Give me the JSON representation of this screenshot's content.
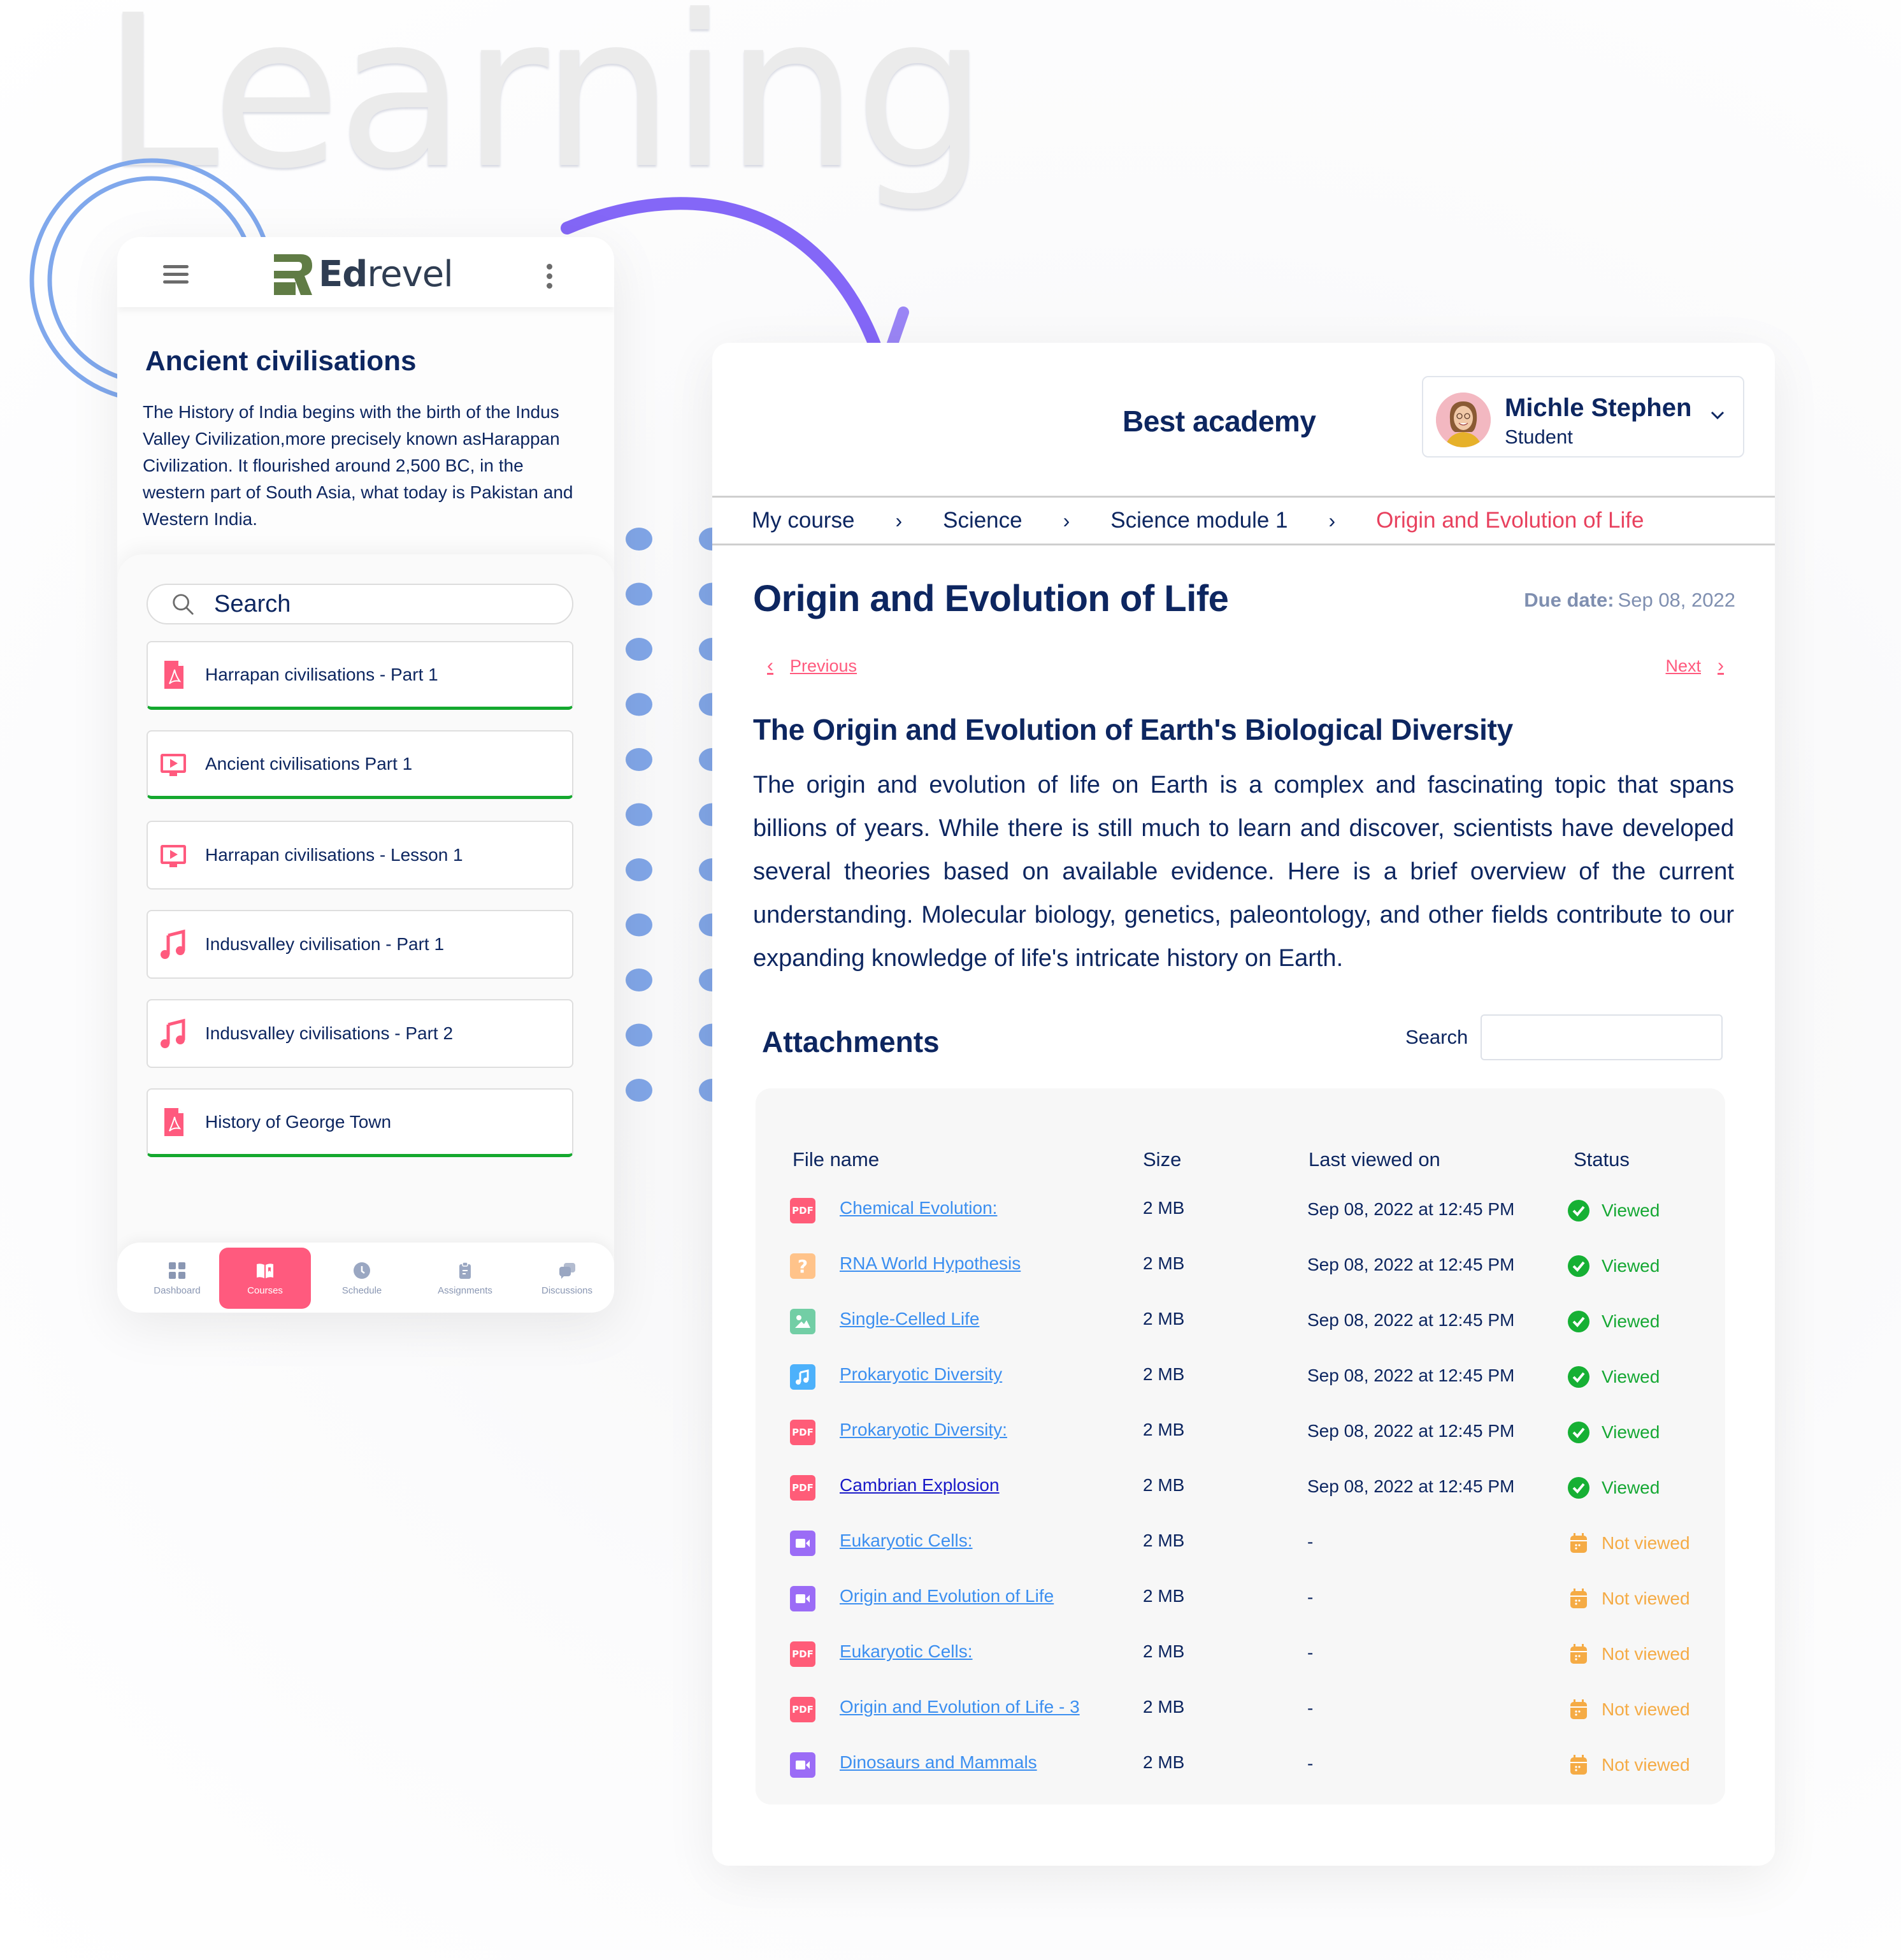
{
  "background": {
    "word": "Learning"
  },
  "colors": {
    "navy": "#0d2660",
    "accent_pink": "#ff5a7e",
    "breadcrumb_current": "#e8415e",
    "viewed_green": "#16a834",
    "not_viewed_orange": "#f5ab45",
    "link_blue": "#3c8ff0",
    "logo_green": "#607c45",
    "deco_blue": "#80a8ec",
    "deco_purple": "#8467f7"
  },
  "mobile": {
    "header": {
      "brand_bold": "Ed",
      "brand_light": "revel",
      "menu_icon": "hamburger-icon",
      "more_icon": "kebab-icon"
    },
    "title": "Ancient civilisations",
    "description": "The History of India begins with the birth of the Indus Valley Civilization,more precisely known asHarappan Civilization. It flourished around 2,500 BC, in the western part of South Asia, what today is Pakistan and Western India.",
    "search": {
      "placeholder": "Search",
      "icon": "search-icon"
    },
    "lessons": [
      {
        "label": "Harrapan civilisations - Part 1",
        "type": "pdf",
        "completed": true
      },
      {
        "label": "Ancient civilisations Part 1",
        "type": "video",
        "completed": true
      },
      {
        "label": "Harrapan civilisations - Lesson 1",
        "type": "video",
        "completed": false
      },
      {
        "label": "Indusvalley civilisation - Part 1",
        "type": "audio",
        "completed": false
      },
      {
        "label": "Indusvalley civilisations - Part 2",
        "type": "audio",
        "completed": false
      },
      {
        "label": "History of George Town",
        "type": "pdf",
        "completed": true
      }
    ],
    "bottom_nav": [
      {
        "label": "Dashboard",
        "icon": "dashboard-icon",
        "active": false
      },
      {
        "label": "Courses",
        "icon": "book-icon",
        "active": true
      },
      {
        "label": "Schedule",
        "icon": "clock-icon",
        "active": false
      },
      {
        "label": "Assignments",
        "icon": "clipboard-icon",
        "active": false
      },
      {
        "label": "Discussions",
        "icon": "chat-icon",
        "active": false
      }
    ]
  },
  "desktop": {
    "academy_name": "Best academy",
    "user": {
      "name": "Michle Stephen",
      "role": "Student"
    },
    "breadcrumb": [
      "My course",
      "Science",
      "Science module 1",
      "Origin and Evolution of Life"
    ],
    "page_title": "Origin and Evolution of Life",
    "due_label": "Due date:",
    "due_value": "Sep 08, 2022",
    "prev_label": "Previous",
    "next_label": "Next",
    "section_title": "The Origin and Evolution of Earth's Biological Diversity",
    "body": "The origin and evolution of life on Earth is a complex and fascinating topic that spans billions of years. While there is still much to learn and discover, scientists have developed several theories based on available evidence. Here is a brief overview of the current understanding. Molecular biology, genetics, paleontology, and other fields contribute to our expanding knowledge of life's intricate history on Earth.",
    "attachments": {
      "title": "Attachments",
      "search_label": "Search",
      "search_value": "",
      "columns": [
        "File name",
        "Size",
        "Last viewed on",
        "Status"
      ],
      "rows": [
        {
          "name": "Chemical Evolution:",
          "type": "pdf",
          "size": "2 MB",
          "last_viewed": "Sep 08, 2022 at 12:45 PM",
          "status": "Viewed",
          "visited": false
        },
        {
          "name": "RNA World Hypothesis",
          "type": "unknown",
          "size": "2 MB",
          "last_viewed": "Sep 08, 2022 at 12:45 PM",
          "status": "Viewed",
          "visited": false
        },
        {
          "name": "Single-Celled Life",
          "type": "image",
          "size": "2 MB",
          "last_viewed": "Sep 08, 2022 at 12:45 PM",
          "status": "Viewed",
          "visited": false
        },
        {
          "name": "Prokaryotic Diversity",
          "type": "audio",
          "size": "2 MB",
          "last_viewed": "Sep 08, 2022 at 12:45 PM",
          "status": "Viewed",
          "visited": false
        },
        {
          "name": "Prokaryotic Diversity:",
          "type": "pdf",
          "size": "2 MB",
          "last_viewed": "Sep 08, 2022 at 12:45 PM",
          "status": "Viewed",
          "visited": false
        },
        {
          "name": "Cambrian Explosion",
          "type": "pdf",
          "size": "2 MB",
          "last_viewed": "Sep 08, 2022 at 12:45 PM",
          "status": "Viewed",
          "visited": true
        },
        {
          "name": "Eukaryotic Cells:",
          "type": "video",
          "size": "2 MB",
          "last_viewed": "-",
          "status": "Not viewed",
          "visited": false
        },
        {
          "name": "Origin and Evolution of Life",
          "type": "video",
          "size": "2 MB",
          "last_viewed": "-",
          "status": "Not viewed",
          "visited": false
        },
        {
          "name": "Eukaryotic Cells:",
          "type": "pdf",
          "size": "2 MB",
          "last_viewed": "-",
          "status": "Not viewed",
          "visited": false
        },
        {
          "name": "Origin and Evolution of Life -  3",
          "type": "pdf",
          "size": "2 MB",
          "last_viewed": "-",
          "status": "Not viewed",
          "visited": false
        },
        {
          "name": "Dinosaurs and Mammals",
          "type": "video",
          "size": "2 MB",
          "last_viewed": "-",
          "status": "Not viewed",
          "visited": false
        }
      ]
    }
  }
}
